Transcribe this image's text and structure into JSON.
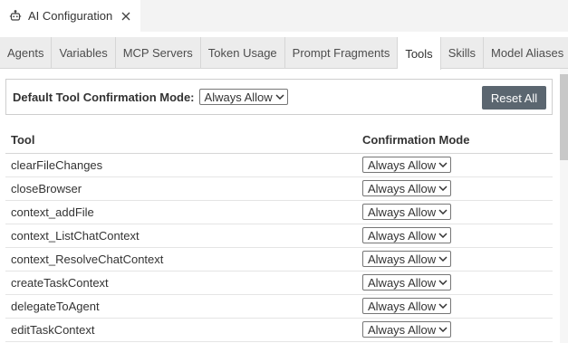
{
  "editor_tab": {
    "title": "AI Configuration",
    "icon": "robot-icon",
    "close_icon": "close-icon"
  },
  "config_tabs": [
    {
      "label": "Agents"
    },
    {
      "label": "Variables"
    },
    {
      "label": "MCP Servers"
    },
    {
      "label": "Token Usage"
    },
    {
      "label": "Prompt Fragments"
    },
    {
      "label": "Tools"
    },
    {
      "label": "Skills"
    },
    {
      "label": "Model Aliases"
    }
  ],
  "active_tab": "Tools",
  "default_mode": {
    "label": "Default Tool Confirmation Mode:",
    "value": "Always Allow"
  },
  "reset_label": "Reset All",
  "table": {
    "headers": {
      "tool": "Tool",
      "mode": "Confirmation Mode"
    },
    "rows": [
      {
        "tool": "clearFileChanges",
        "mode": "Always Allow"
      },
      {
        "tool": "closeBrowser",
        "mode": "Always Allow"
      },
      {
        "tool": "context_addFile",
        "mode": "Always Allow"
      },
      {
        "tool": "context_ListChatContext",
        "mode": "Always Allow"
      },
      {
        "tool": "context_ResolveChatContext",
        "mode": "Always Allow"
      },
      {
        "tool": "createTaskContext",
        "mode": "Always Allow"
      },
      {
        "tool": "delegateToAgent",
        "mode": "Always Allow"
      },
      {
        "tool": "editTaskContext",
        "mode": "Always Allow"
      }
    ]
  },
  "colors": {
    "reset_button_bg": "#5b6670",
    "tab_bar_bg": "#ececec"
  }
}
